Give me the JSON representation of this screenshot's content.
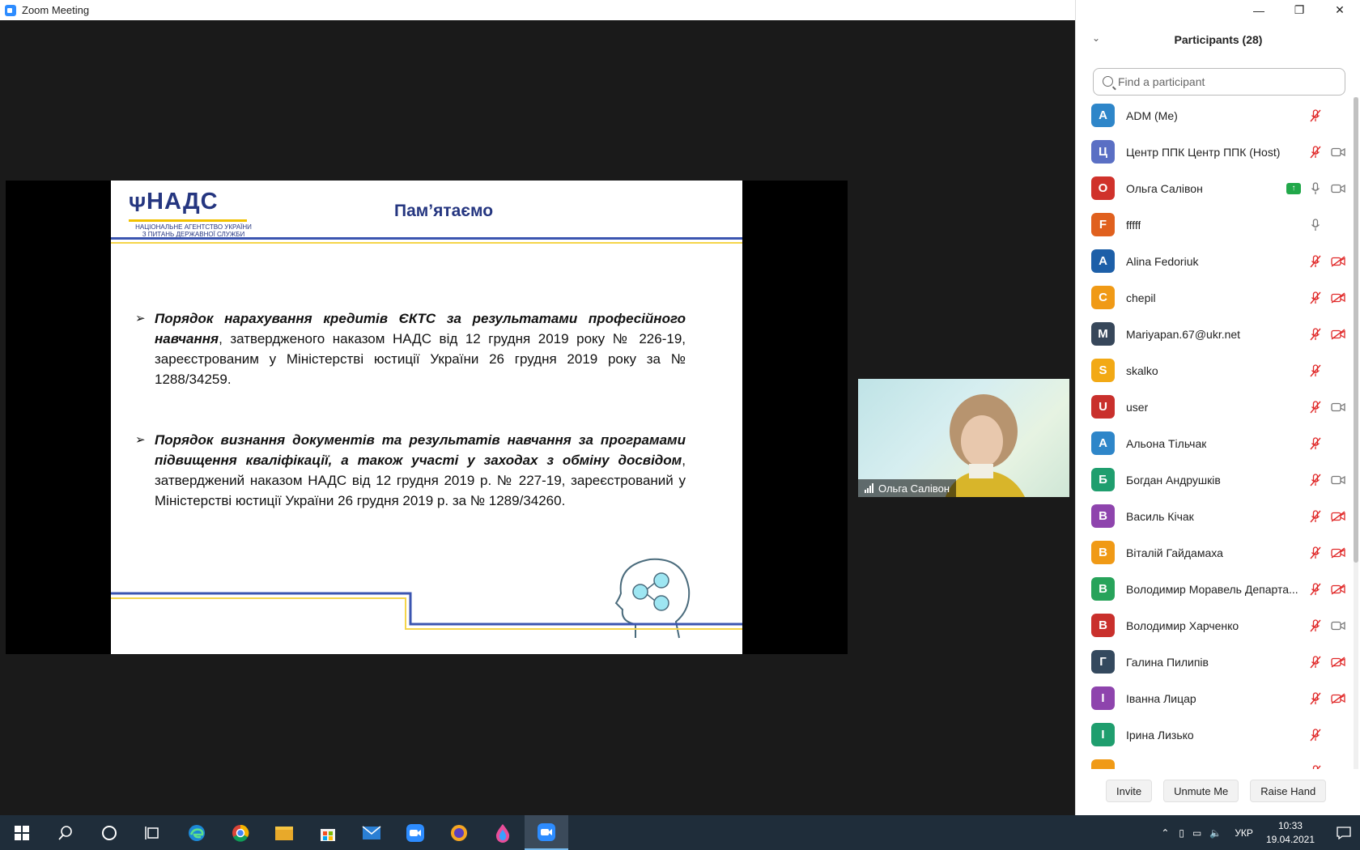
{
  "window": {
    "title": "Zoom Meeting"
  },
  "slide": {
    "logo_name": "НАДС",
    "logo_sub_1": "НАЦІОНАЛЬНЕ АГЕНТСТВО УКРАЇНИ",
    "logo_sub_2": "З ПИТАНЬ ДЕРЖАВНОЇ СЛУЖБИ",
    "title": "Пам’ятаємо",
    "bullet1_bold": "Порядок нарахування кредитів ЄКТС за результатами професійного навчання",
    "bullet1_rest": ", затвердженого наказом НАДС від 12 грудня 2019 року № 226-19, зареєстрованим у Міністерстві юстиції України 26 грудня 2019 року за № 1288/34259.",
    "bullet2_bold": "Порядок визнання документів та результатів навчання за програмами підвищення кваліфікації, а також участі у заходах з обміну досвідом",
    "bullet2_rest": ", затверджений наказом НАДС від 12 грудня 2019 р. № 227-19, зареєстрований у Міністерстві юстиції України 26 грудня 2019 р. за № 1289/34260."
  },
  "video": {
    "name": "Ольга Салівон"
  },
  "participants_panel": {
    "title": "Participants (28)",
    "search_placeholder": "Find a participant",
    "participants": [
      {
        "initial": "A",
        "name": "ADM (Me)",
        "color": "#2e86c9",
        "mic": "muted",
        "video": "none"
      },
      {
        "initial": "Ц",
        "name": "Центр ППК Центр ППК (Host)",
        "color": "#5a6fc4",
        "mic": "muted",
        "video": "on"
      },
      {
        "initial": "О",
        "name": "Ольга Салівон",
        "color": "#d0322b",
        "mic": "on",
        "video": "on",
        "share": true
      },
      {
        "initial": "F",
        "name": "fffff",
        "color": "#e0601e",
        "mic": "on",
        "video": "none"
      },
      {
        "initial": "A",
        "name": "Alina Fedoriuk",
        "color": "#1d5fa8",
        "mic": "muted",
        "video": "off"
      },
      {
        "initial": "C",
        "name": "chepil",
        "color": "#f09a16",
        "mic": "muted",
        "video": "off"
      },
      {
        "initial": "M",
        "name": "Mariyapan.67@ukr.net",
        "color": "#37475a",
        "mic": "muted",
        "video": "off"
      },
      {
        "initial": "S",
        "name": "skalko",
        "color": "#f2a915",
        "mic": "muted",
        "video": "none"
      },
      {
        "initial": "U",
        "name": "user",
        "color": "#c9302c",
        "mic": "muted",
        "video": "on"
      },
      {
        "initial": "А",
        "name": "Альона Тільчак",
        "color": "#2e86c9",
        "mic": "muted",
        "video": "none"
      },
      {
        "initial": "Б",
        "name": "Богдан Андрушків",
        "color": "#1f9e6e",
        "mic": "muted",
        "video": "on"
      },
      {
        "initial": "В",
        "name": "Василь Кічак",
        "color": "#8e44ad",
        "mic": "muted",
        "video": "off"
      },
      {
        "initial": "В",
        "name": "Віталій Гайдамаха",
        "color": "#f09a16",
        "mic": "muted",
        "video": "off"
      },
      {
        "initial": "В",
        "name": "Володимир Моравель Департа...",
        "color": "#27a35a",
        "mic": "muted",
        "video": "off"
      },
      {
        "initial": "В",
        "name": "Володимир Харченко",
        "color": "#c9302c",
        "mic": "muted",
        "video": "on"
      },
      {
        "initial": "Г",
        "name": "Галина Пилипів",
        "color": "#34495e",
        "mic": "muted",
        "video": "off"
      },
      {
        "initial": "І",
        "name": "Іванна Лицар",
        "color": "#8e44ad",
        "mic": "muted",
        "video": "off"
      },
      {
        "initial": "І",
        "name": "Ірина Лизько",
        "color": "#1f9e6e",
        "mic": "muted",
        "video": "none"
      },
      {
        "initial": "",
        "name": "",
        "color": "#f09a16",
        "mic": "muted",
        "video": "none"
      }
    ],
    "buttons": {
      "invite": "Invite",
      "unmute": "Unmute Me",
      "raise": "Raise Hand"
    }
  },
  "taskbar": {
    "lang": "УКР",
    "time": "10:33",
    "date": "19.04.2021"
  },
  "colors": {
    "accent": "#2d8cff",
    "mute_red": "#e02828",
    "slide_blue": "#253680",
    "slide_yellow": "#f5d54a"
  }
}
